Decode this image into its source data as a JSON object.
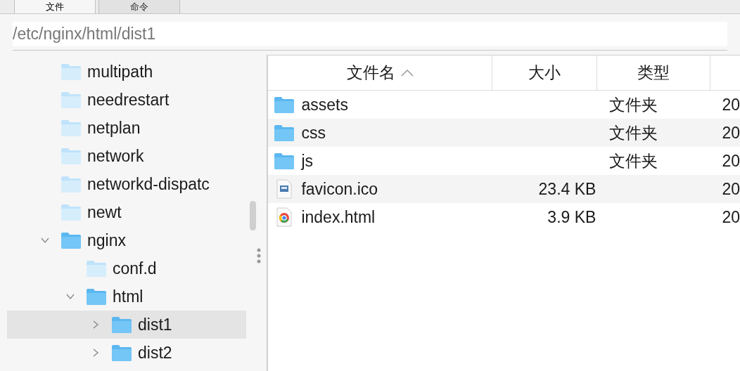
{
  "tabs": [
    {
      "label": "文件",
      "selected": true
    },
    {
      "label": "命令",
      "selected": false
    }
  ],
  "path": "/etc/nginx/html/dist1",
  "tree": [
    {
      "name": "multipath",
      "selected": false
    },
    {
      "name": "needrestart",
      "selected": false
    },
    {
      "name": "netplan",
      "selected": false
    },
    {
      "name": "network",
      "selected": false
    },
    {
      "name": "networkd-dispatc",
      "selected": false
    },
    {
      "name": "newt",
      "selected": false
    },
    {
      "name": "nginx",
      "expanded": true,
      "selected": false,
      "children": [
        {
          "name": "conf.d",
          "selected": false
        },
        {
          "name": "html",
          "expanded": true,
          "selected": false,
          "children": [
            {
              "name": "dist1",
              "expanded": false,
              "selected": true
            },
            {
              "name": "dist2",
              "expanded": false,
              "selected": false
            }
          ]
        }
      ]
    }
  ],
  "table": {
    "columns": [
      {
        "label": "文件名",
        "sorted": true
      },
      {
        "label": "大小",
        "sorted": false
      },
      {
        "label": "类型",
        "sorted": false
      }
    ],
    "rows": [
      {
        "kind": "folder",
        "name": "assets",
        "type": "文件夹",
        "column_4": "20"
      },
      {
        "kind": "folder",
        "name": "css",
        "type": "文件夹",
        "column_4": "20"
      },
      {
        "kind": "folder",
        "name": "js",
        "type": "文件夹",
        "column_4": "20"
      },
      {
        "kind": "icon",
        "name": "favicon.ico",
        "size": "23.4 KB",
        "column_4": "20"
      },
      {
        "kind": "html",
        "name": "index.html",
        "size": "3.9 KB",
        "column_4": "20"
      }
    ]
  }
}
